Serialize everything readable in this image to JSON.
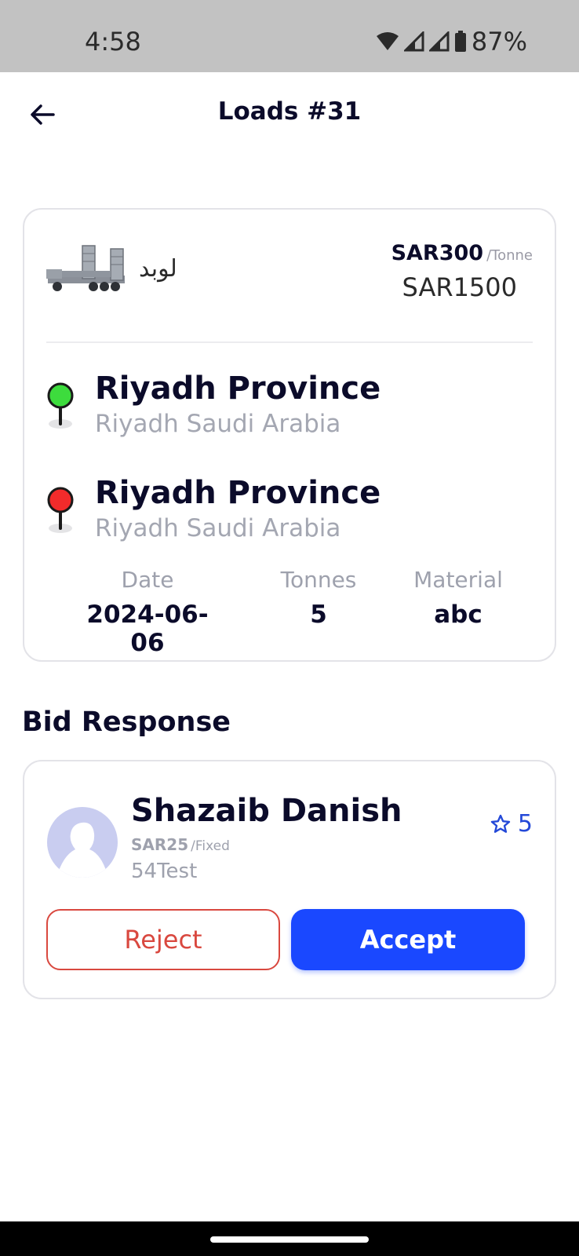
{
  "status_bar": {
    "time": "4:58",
    "battery": "87%"
  },
  "header": {
    "title": "Loads #31",
    "back_icon": "arrow-left-icon"
  },
  "load": {
    "truck_name": "لوبد",
    "rate_amount": "SAR300",
    "rate_unit": "/Tonne",
    "total": "SAR1500",
    "pickup": {
      "title": "Riyadh Province",
      "subtitle": "Riyadh Saudi Arabia",
      "pin_color": "#3ddc3d"
    },
    "dropoff": {
      "title": "Riyadh Province",
      "subtitle": "Riyadh Saudi Arabia",
      "pin_color": "#f22b2b"
    },
    "stats": {
      "date_label": "Date",
      "date_value": "2024-06-06",
      "tonnes_label": "Tonnes",
      "tonnes_value": "5",
      "material_label": "Material",
      "material_value": "abc"
    }
  },
  "bid_section": {
    "title": "Bid Response",
    "bidder": {
      "name": "Shazaib Danish",
      "price_amount": "SAR25",
      "price_unit": "/Fixed",
      "note": "54Test",
      "rating": "5",
      "rating_icon": "star-outline-icon"
    },
    "reject_label": "Reject",
    "accept_label": "Accept"
  },
  "colors": {
    "accent": "#1a48ff",
    "reject": "#d9483f",
    "rating": "#2449d8"
  }
}
